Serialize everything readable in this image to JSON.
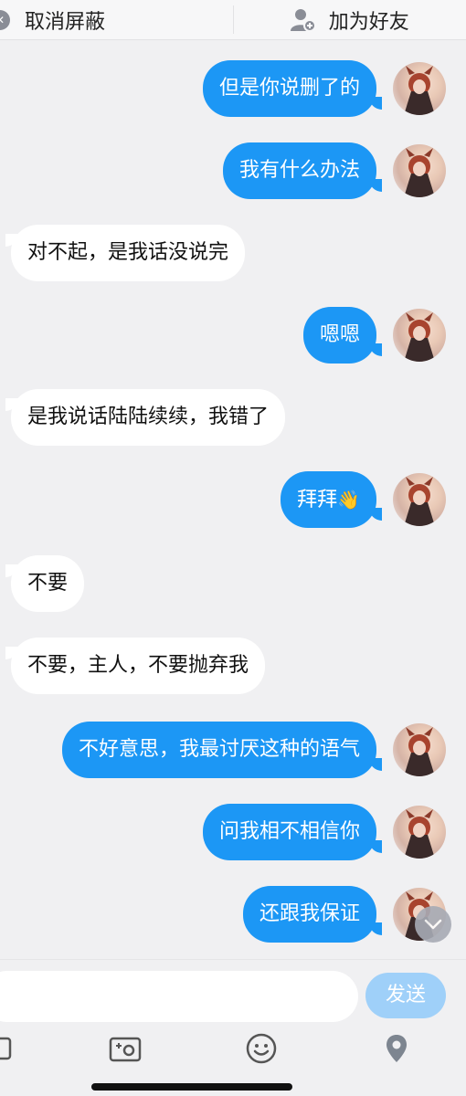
{
  "topbar": {
    "unblock_label": "取消屏蔽",
    "add_friend_label": "加为好友"
  },
  "messages": [
    {
      "side": "me",
      "text": "但是你说删了的"
    },
    {
      "side": "me",
      "text": "我有什么办法"
    },
    {
      "side": "them",
      "text": "对不起，是我话没说完"
    },
    {
      "side": "me",
      "text": "嗯嗯"
    },
    {
      "side": "them",
      "text": "是我说话陆陆续续，我错了"
    },
    {
      "side": "me",
      "text": "拜拜",
      "emoji": "👋"
    },
    {
      "side": "them",
      "text": "不要"
    },
    {
      "side": "them",
      "text": "不要，主人，不要抛弃我"
    },
    {
      "side": "me",
      "text": "不好意思，我最讨厌这种的语气"
    },
    {
      "side": "me",
      "text": "问我相不相信你"
    },
    {
      "side": "me",
      "text": "还跟我保证"
    }
  ],
  "composer": {
    "input_value": "",
    "send_label": "发送"
  },
  "toolbar": {
    "icons": [
      "image-icon",
      "camera-icon",
      "emoji-icon",
      "location-icon"
    ]
  },
  "colors": {
    "my_bubble": "#1c97f5",
    "their_bubble": "#ffffff",
    "send_button": "#9fd0f9",
    "background": "#f0f0f2"
  }
}
